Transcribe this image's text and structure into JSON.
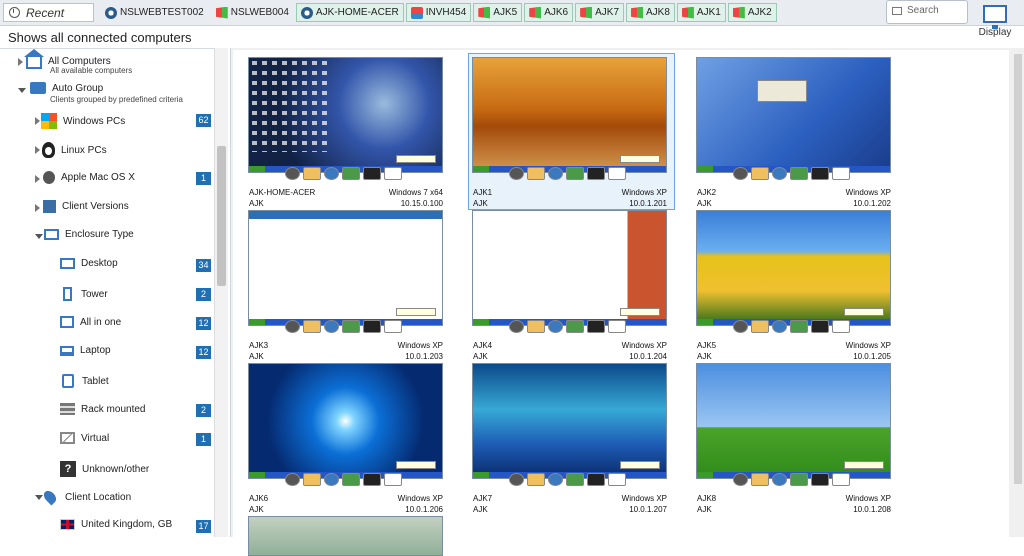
{
  "topbar": {
    "recent_label": "Recent",
    "tabs": [
      {
        "label": "NSLWEBTEST002",
        "icon": "osx-icon",
        "highlight": false
      },
      {
        "label": "NSLWEB004",
        "icon": "windows-icon",
        "highlight": false
      },
      {
        "label": "AJK-HOME-ACER",
        "icon": "osx-icon",
        "highlight": true
      },
      {
        "label": "INVH454",
        "icon": "windows-icon",
        "highlight": true
      },
      {
        "label": "AJK5",
        "icon": "windows-icon",
        "highlight": true
      },
      {
        "label": "AJK6",
        "icon": "windows-icon",
        "highlight": true
      },
      {
        "label": "AJK7",
        "icon": "windows-icon",
        "highlight": true
      },
      {
        "label": "AJK8",
        "icon": "windows-icon",
        "highlight": true
      },
      {
        "label": "AJK1",
        "icon": "windows-icon",
        "highlight": true
      },
      {
        "label": "AJK2",
        "icon": "windows-icon",
        "highlight": true
      }
    ],
    "search_placeholder": "Search",
    "display_label": "Display"
  },
  "heading": "Shows all connected computers",
  "sidebar": {
    "items": [
      {
        "label": "All Computers",
        "sub": "All available computers",
        "icon": "home-icon",
        "count": ""
      },
      {
        "label": "Auto Group",
        "sub": "Clients grouped by predefined criteria",
        "icon": "group-icon",
        "count": ""
      },
      {
        "label": "Windows PCs",
        "icon": "windows-logo-icon",
        "count": "62"
      },
      {
        "label": "Linux PCs",
        "icon": "linux-icon",
        "count": ""
      },
      {
        "label": "Apple Mac OS X",
        "icon": "apple-icon",
        "count": "1"
      },
      {
        "label": "Client Versions",
        "icon": "client-versions-icon",
        "count": ""
      },
      {
        "label": "Enclosure Type",
        "icon": "enclosure-icon",
        "count": ""
      },
      {
        "label": "Desktop",
        "icon": "desktop-icon",
        "count": "34"
      },
      {
        "label": "Tower",
        "icon": "tower-icon",
        "count": "2"
      },
      {
        "label": "All in one",
        "icon": "all-in-one-icon",
        "count": "12"
      },
      {
        "label": "Laptop",
        "icon": "laptop-icon",
        "count": "12"
      },
      {
        "label": "Tablet",
        "icon": "tablet-icon",
        "count": ""
      },
      {
        "label": "Rack mounted",
        "icon": "rack-icon",
        "count": "2"
      },
      {
        "label": "Virtual",
        "icon": "virtual-icon",
        "count": "1"
      },
      {
        "label": "Unknown/other",
        "icon": "unknown-icon",
        "count": ""
      },
      {
        "label": "Client Location",
        "icon": "location-pin-icon",
        "count": ""
      },
      {
        "label": "United Kingdom, GB",
        "icon": "uk-flag-icon",
        "count": "17"
      }
    ]
  },
  "computers": [
    {
      "name": "AJK-HOME-ACER",
      "os": "Windows 7 x64",
      "group": "AJK",
      "ip": "10.15.0.100"
    },
    {
      "name": "AJK1",
      "os": "Windows XP",
      "group": "AJK",
      "ip": "10.0.1.201"
    },
    {
      "name": "AJK2",
      "os": "Windows XP",
      "group": "AJK",
      "ip": "10.0.1.202"
    },
    {
      "name": "AJK3",
      "os": "Windows XP",
      "group": "AJK",
      "ip": "10.0.1.203"
    },
    {
      "name": "AJK4",
      "os": "Windows XP",
      "group": "AJK",
      "ip": "10.0.1.204"
    },
    {
      "name": "AJK5",
      "os": "Windows XP",
      "group": "AJK",
      "ip": "10.0.1.205"
    },
    {
      "name": "AJK6",
      "os": "Windows XP",
      "group": "AJK",
      "ip": "10.0.1.206"
    },
    {
      "name": "AJK7",
      "os": "Windows XP",
      "group": "AJK",
      "ip": "10.0.1.207"
    },
    {
      "name": "AJK8",
      "os": "Windows XP",
      "group": "AJK",
      "ip": "10.0.1.208"
    }
  ],
  "colors": {
    "accent": "#1f6fb2",
    "tab_highlight": "#dff2ea",
    "selection": "#6aa8d8"
  }
}
